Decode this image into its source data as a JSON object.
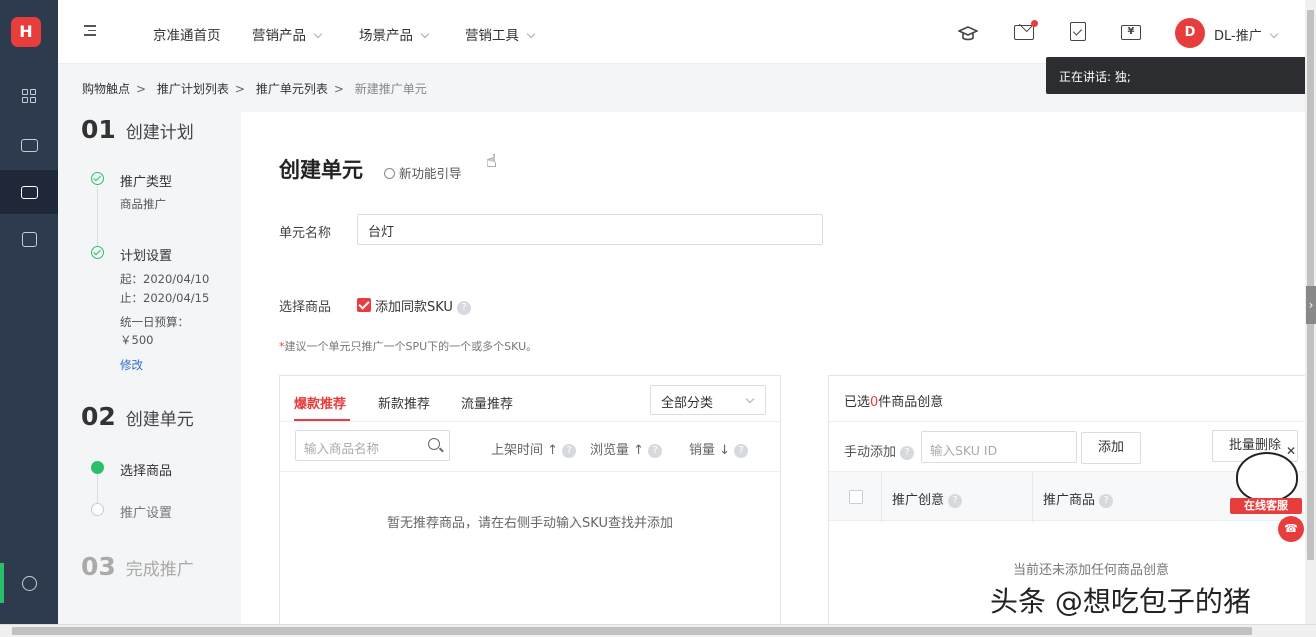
{
  "sidebar": {
    "logo": "H",
    "icons": [
      "dashboard-icon",
      "monitor-icon",
      "briefcase-icon",
      "report-icon",
      "clock-icon"
    ]
  },
  "header": {
    "nav": [
      {
        "label": "京准通首页",
        "has_dropdown": false
      },
      {
        "label": "营销产品",
        "has_dropdown": true
      },
      {
        "label": "场景产品",
        "has_dropdown": true
      },
      {
        "label": "营销工具",
        "has_dropdown": true
      }
    ],
    "icons": [
      "graduation-cap-icon",
      "mail-icon",
      "task-icon",
      "yen-icon"
    ],
    "avatar_letter": "D",
    "user_name": "DL-推广"
  },
  "tooltip": "正在讲话: 独;",
  "breadcrumb": [
    "购物触点",
    "推广计划列表",
    "推广单元列表",
    "新建推广单元"
  ],
  "steps": {
    "s1_num": "01",
    "s1_title": "创建计划",
    "s1_items": [
      {
        "label": "推广类型",
        "sub": "商品推广"
      },
      {
        "label": "计划设置"
      }
    ],
    "start": "起：2020/04/10",
    "end": "止：2020/04/15",
    "budget_label": "统一日预算：",
    "budget_value": "￥500",
    "edit": "修改",
    "s2_num": "02",
    "s2_title": "创建单元",
    "s2_items": [
      "选择商品",
      "推广设置"
    ],
    "s3_num": "03",
    "s3_title": "完成推广"
  },
  "form": {
    "title": "创建单元",
    "guide": "新功能引导",
    "name_label": "单元名称",
    "name_value": "台灯",
    "product_label": "选择商品",
    "add_sku_label": "添加同款SKU",
    "hint_star": "*",
    "hint": "建议一个单元只推广一个SPU下的一个或多个SKU。"
  },
  "left_panel": {
    "tabs": [
      "爆款推荐",
      "新款推荐",
      "流量推荐"
    ],
    "category": "全部分类",
    "search_placeholder": "输入商品名称",
    "sorts": [
      "上架时间 ↑",
      "浏览量 ↑",
      "销量 ↓"
    ],
    "empty": "暂无推荐商品，请在右侧手动输入SKU查找并添加"
  },
  "right_panel": {
    "selected_prefix": "已选",
    "selected_count": "0",
    "selected_suffix": "件商品创意",
    "manual_label": "手动添加",
    "sku_placeholder": "输入SKU ID",
    "add_button": "添加",
    "batch_delete": "批量删除",
    "col_creative": "推广创意",
    "col_product": "推广商品",
    "empty": "当前还未添加任何商品创意"
  },
  "service": {
    "banner": "在线客服"
  },
  "watermark": "头条 @想吃包子的猪"
}
